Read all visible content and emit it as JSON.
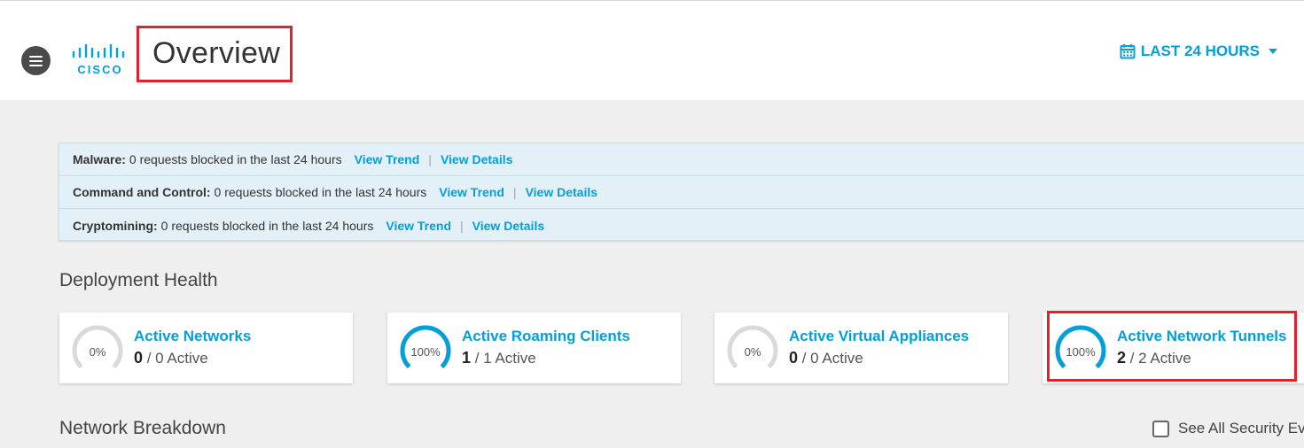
{
  "header": {
    "logo_text": "CISCO",
    "title": "Overview",
    "time_range": "LAST 24 HOURS"
  },
  "alerts": [
    {
      "label": "Malware:",
      "text": "0 requests blocked in the last 24 hours",
      "trend": "View Trend",
      "sep": "|",
      "details": "View Details"
    },
    {
      "label": "Command and Control:",
      "text": "0 requests blocked in the last 24 hours",
      "trend": "View Trend",
      "sep": "|",
      "details": "View Details"
    },
    {
      "label": "Cryptomining:",
      "text": "0 requests blocked in the last 24 hours",
      "trend": "View Trend",
      "sep": "|",
      "details": "View Details"
    }
  ],
  "deployment": {
    "title": "Deployment Health",
    "cards": [
      {
        "name": "Active Networks",
        "percent_label": "0%",
        "percent": 0,
        "active": "0",
        "rest": " / 0 Active"
      },
      {
        "name": "Active Roaming Clients",
        "percent_label": "100%",
        "percent": 100,
        "active": "1",
        "rest": " / 1 Active"
      },
      {
        "name": "Active Virtual Appliances",
        "percent_label": "0%",
        "percent": 0,
        "active": "0",
        "rest": " / 0 Active"
      },
      {
        "name": "Active Network Tunnels",
        "percent_label": "100%",
        "percent": 100,
        "active": "2",
        "rest": " / 2 Active"
      }
    ]
  },
  "breakdown": {
    "title": "Network Breakdown",
    "checkbox_label": "See All Security Ev"
  },
  "colors": {
    "accent": "#049fd9",
    "gauge_track": "#d9d9d9",
    "highlight": "#e3202b",
    "alert_bg": "#e3f0f8"
  },
  "icons": {
    "menu": "hamburger-icon",
    "range": "calendar-icon",
    "range_caret": "caret-down-icon"
  }
}
